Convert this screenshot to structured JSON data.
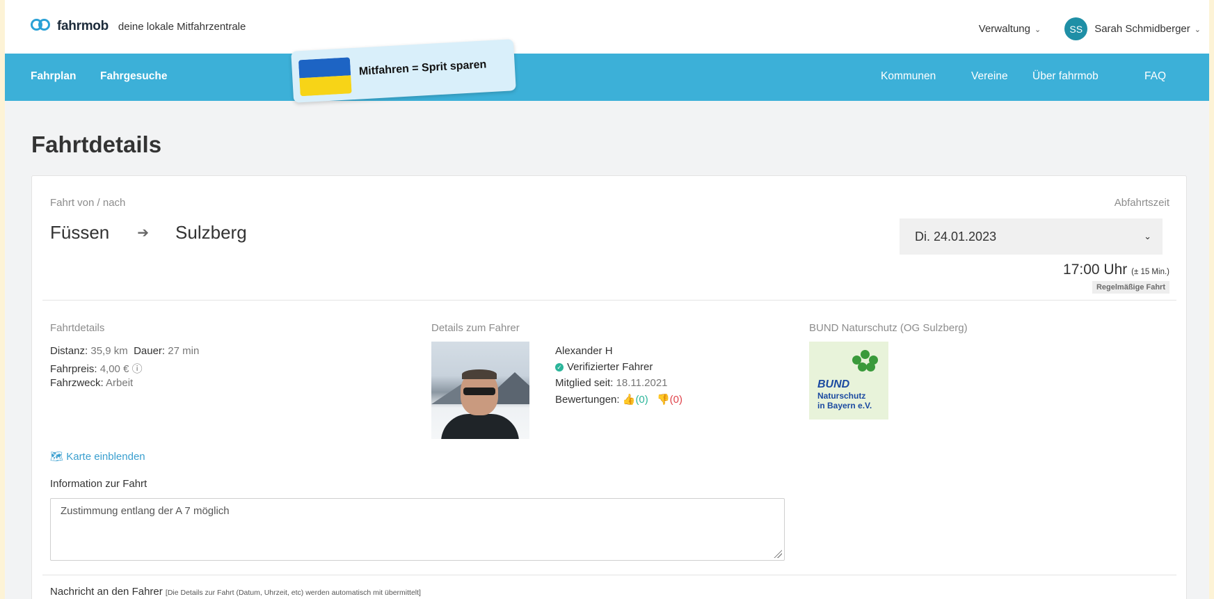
{
  "header": {
    "brand": "fahrmob",
    "tagline": "deine lokale Mitfahrzentrale",
    "admin_menu": "Verwaltung",
    "user_initials": "SS",
    "user_name": "Sarah Schmidberger",
    "chevron": "⌄"
  },
  "nav": {
    "left": [
      "Fahrplan",
      "Fahrgesuche"
    ],
    "right": [
      "Kommunen",
      "Vereine",
      "Über fahrmob",
      "FAQ"
    ],
    "banner_text": "Mitfahren = Sprit sparen"
  },
  "page": {
    "title": "Fahrtdetails"
  },
  "ride": {
    "route_label": "Fahrt von / nach",
    "from": "Füssen",
    "arrow": "➔",
    "to": "Sulzberg",
    "departure_label": "Abfahrtszeit",
    "date": "Di. 24.01.2023",
    "time": "17:00 Uhr",
    "time_tolerance": "(± 15 Min.)",
    "recurring_badge": "Regelmäßige Fahrt"
  },
  "details": {
    "heading": "Fahrtdetails",
    "distance_label": "Distanz:",
    "distance": "35,9 km",
    "duration_label": "Dauer:",
    "duration": "27 min",
    "price_label": "Fahrpreis:",
    "price": "4,00 €",
    "purpose_label": "Fahrzweck:",
    "purpose": "Arbeit"
  },
  "driver": {
    "heading": "Details zum Fahrer",
    "name": "Alexander H",
    "verified": "Verifizierter Fahrer",
    "member_since_label": "Mitglied seit:",
    "member_since": "18.11.2021",
    "ratings_label": "Bewertungen:",
    "ratings_up": "(0)",
    "ratings_down": "(0)"
  },
  "club": {
    "heading": "BUND Naturschutz (OG Sulzberg)",
    "logo_word": "BUND",
    "logo_line1": "Naturschutz",
    "logo_line2": "in Bayern e.V."
  },
  "map_link": "Karte einblenden",
  "info": {
    "heading": "Information zur Fahrt",
    "text": "Zustimmung entlang der A 7 möglich"
  },
  "message": {
    "heading": "Nachricht an den Fahrer",
    "note": "[Die Details zur Fahrt (Datum, Uhrzeit, etc) werden automatisch mit übermittelt]"
  }
}
